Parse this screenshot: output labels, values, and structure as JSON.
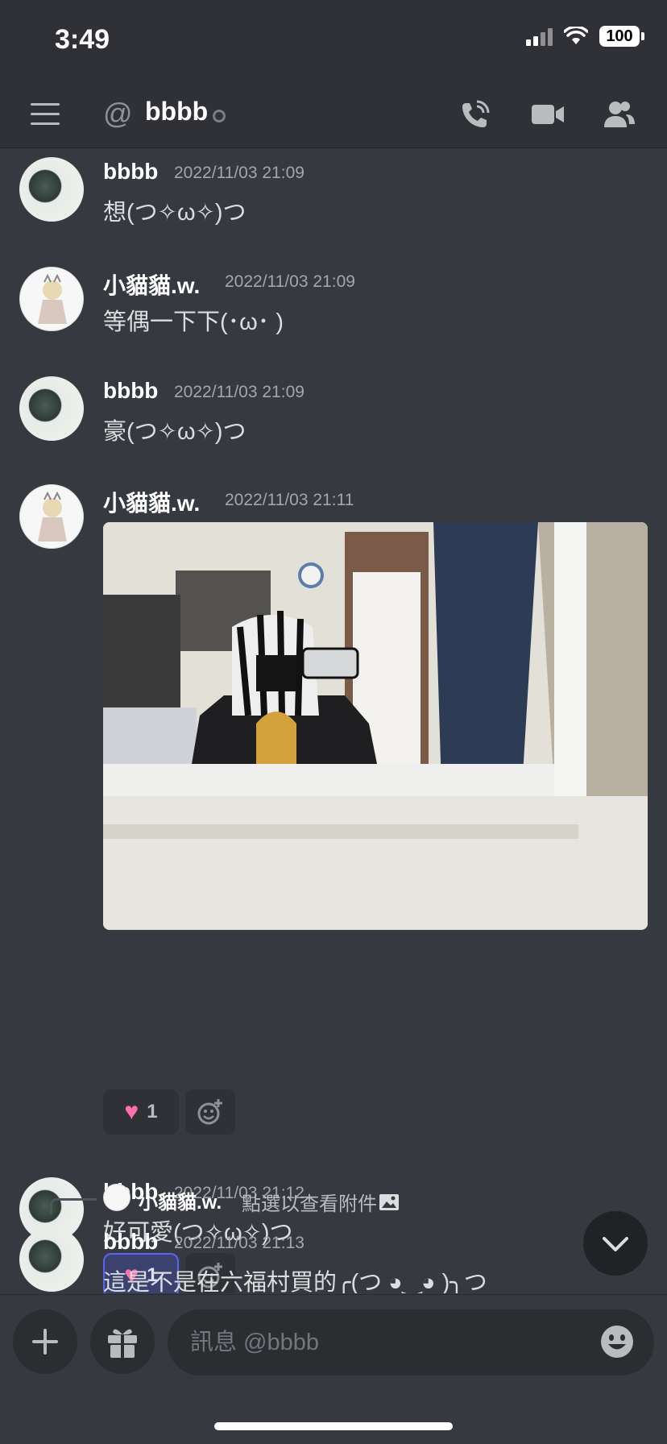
{
  "status_bar": {
    "time": "3:49",
    "battery": "100"
  },
  "header": {
    "at_symbol": "@",
    "channel_name": "bbbb"
  },
  "messages": [
    {
      "author": "bbbb",
      "time": "2022/11/03 21:09",
      "text": "想(つ✧ω✧)つ"
    },
    {
      "author": "小貓貓.w.",
      "time": "2022/11/03 21:09",
      "text": "等偶一下下(･ω･ )"
    },
    {
      "author": "bbbb",
      "time": "2022/11/03 21:09",
      "text": "豪(つ✧ω✧)つ"
    },
    {
      "author": "小貓貓.w.",
      "time": "2022/11/03 21:11",
      "reaction_count": "1"
    },
    {
      "author": "bbbb",
      "time": "2022/11/03 21:12",
      "text": "好可愛(つ✧ω✧)つ",
      "reaction_count": "1"
    },
    {
      "author": "bbbb",
      "time": "2022/11/03 21:13",
      "text": "這是不是在六福村買的╭(つ ◕‿◕ )╮つ"
    }
  ],
  "reply": {
    "author": "小貓貓.w.",
    "text": "點選以查看附件"
  },
  "composer": {
    "placeholder": "訊息 @bbbb"
  },
  "colors": {
    "background": "#36393f",
    "header": "#2f3136",
    "accent": "#5865f2"
  },
  "icons": [
    "hamburger-icon",
    "at-icon",
    "phone-call-icon",
    "video-camera-icon",
    "members-icon",
    "heart-emoji-icon",
    "add-reaction-icon",
    "plus-icon",
    "gift-icon",
    "emoji-icon",
    "chevron-down-icon",
    "image-icon"
  ]
}
